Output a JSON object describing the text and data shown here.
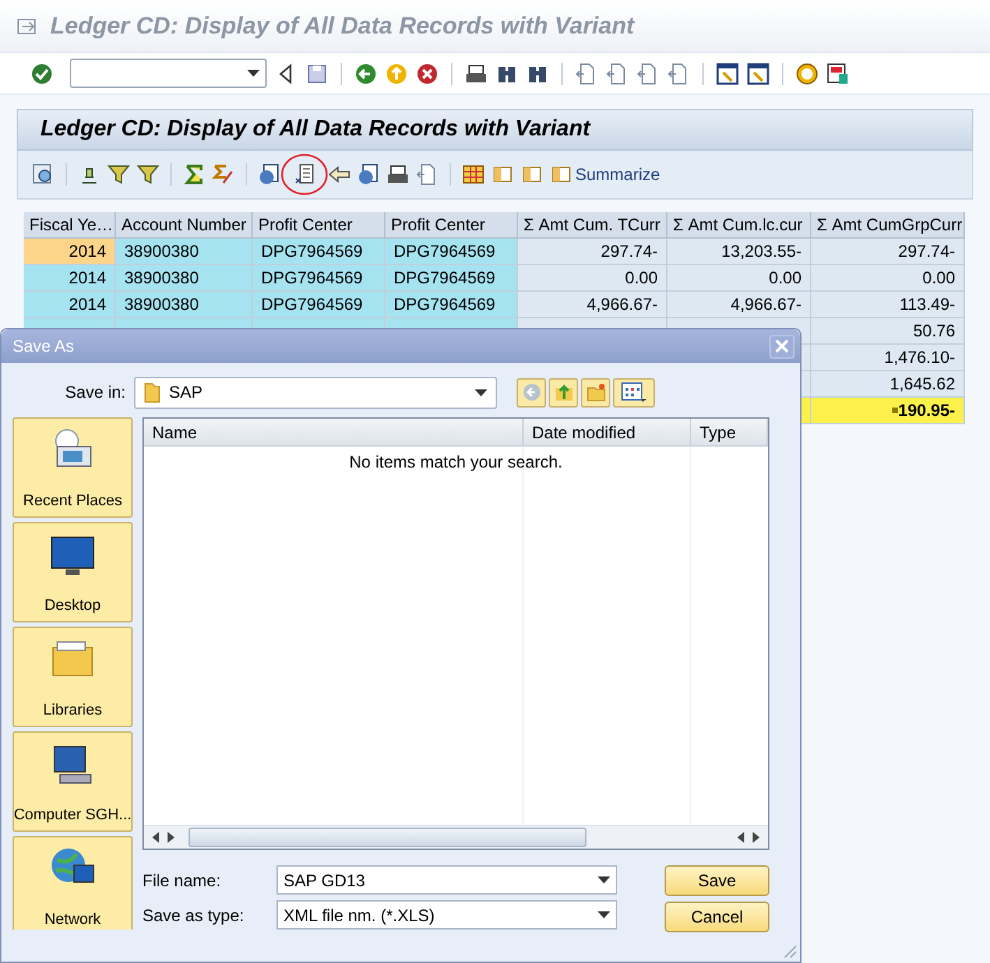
{
  "window": {
    "title": "Ledger CD: Display of All Data Records with Variant"
  },
  "report": {
    "title": "Ledger CD: Display of All Data Records with Variant",
    "summarize_button": "Summarize"
  },
  "table": {
    "columns": [
      "Fiscal Ye…",
      "Account Number",
      "Profit Center",
      "Profit Center",
      "Σ Amt Cum. TCurr",
      "Σ Amt Cum.lc.cur",
      "Σ Amt CumGrpCurr"
    ],
    "rows": [
      {
        "kind": "data",
        "focused": true,
        "cells": [
          "2014",
          "38900380",
          "DPG7964569",
          "DPG7964569",
          "297.74-",
          "13,203.55-",
          "297.74-"
        ]
      },
      {
        "kind": "data",
        "focused": false,
        "cells": [
          "2014",
          "38900380",
          "DPG7964569",
          "DPG7964569",
          "0.00",
          "0.00",
          "0.00"
        ]
      },
      {
        "kind": "data",
        "focused": false,
        "cells": [
          "2014",
          "38900380",
          "DPG7964569",
          "DPG7964569",
          "4,966.67-",
          "4,966.67-",
          "113.49-"
        ]
      },
      {
        "kind": "data",
        "focused": false,
        "cells": [
          "50.76"
        ]
      },
      {
        "kind": "data",
        "focused": false,
        "cells": [
          "1,476.10-"
        ]
      },
      {
        "kind": "data",
        "focused": false,
        "cells": [
          "1,645.62"
        ]
      },
      {
        "kind": "total",
        "focused": false,
        "cells": [
          "190.95-"
        ]
      }
    ]
  },
  "dialog": {
    "title": "Save As",
    "save_in_label": "Save in:",
    "save_in": "SAP",
    "places": [
      {
        "kind": "recent",
        "label": "Recent Places"
      },
      {
        "kind": "desktop",
        "label": "Desktop"
      },
      {
        "kind": "libraries",
        "label": "Libraries"
      },
      {
        "kind": "computer",
        "label": "Computer SGH..."
      },
      {
        "kind": "network",
        "label": "Network"
      }
    ],
    "list_columns": [
      "Name",
      "Date modified",
      "Type"
    ],
    "empty_message": "No items match your search.",
    "file_name_label": "File name:",
    "file_name": "SAP GD13",
    "type_label": "Save as type:",
    "type": "XML file nm. (*.XLS)",
    "buttons": [
      "Save",
      "Cancel"
    ]
  }
}
